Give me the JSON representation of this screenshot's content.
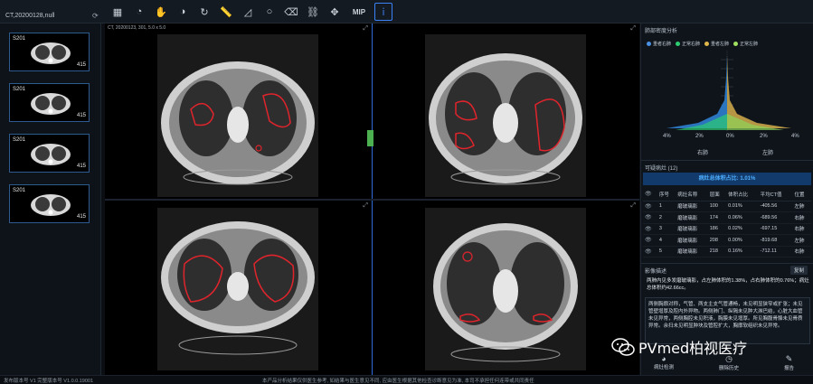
{
  "app": {
    "study_title": "CT,20200128,null",
    "study_icon": "refresh-icon"
  },
  "toolbar": {
    "tools": [
      {
        "name": "layout-grid-icon",
        "glyph": "▦",
        "active": false
      },
      {
        "name": "magnifier-icon",
        "glyph": "◔",
        "active": false
      },
      {
        "name": "pan-hand-icon",
        "glyph": "✋",
        "active": false
      },
      {
        "name": "window-level-icon",
        "glyph": "◑",
        "active": false
      },
      {
        "name": "reset-icon",
        "glyph": "↻",
        "active": false
      },
      {
        "name": "ruler-icon",
        "glyph": "📏",
        "active": false
      },
      {
        "name": "angle-icon",
        "glyph": "◿",
        "active": false
      },
      {
        "name": "ellipse-roi-icon",
        "glyph": "○",
        "active": false
      },
      {
        "name": "eraser-icon",
        "glyph": "⌫",
        "active": false
      },
      {
        "name": "link-icon",
        "glyph": "⛓",
        "active": false
      },
      {
        "name": "move-icon",
        "glyph": "✥",
        "active": false
      },
      {
        "name": "mip-button",
        "glyph": "MIP",
        "active": false
      },
      {
        "name": "info-icon",
        "glyph": "ⅰ",
        "active": true
      }
    ]
  },
  "series": [
    {
      "label": "S201",
      "count": "415"
    },
    {
      "label": "S201",
      "count": "415"
    },
    {
      "label": "S201",
      "count": "415"
    },
    {
      "label": "S201",
      "count": "415"
    }
  ],
  "viewer": {
    "viewport_info": "CT, 20200123, 301, 5.0 x 5.0"
  },
  "density_panel": {
    "title": "肺部密度分析",
    "legend": [
      {
        "label": "重者右肺",
        "color": "#4a90e2"
      },
      {
        "label": "正常右肺",
        "color": "#2ecc71"
      },
      {
        "label": "重者左肺",
        "color": "#e0b64a"
      },
      {
        "label": "正常左肺",
        "color": "#a0e060"
      }
    ],
    "axis_ticks": [
      "4%",
      "2%",
      "0%",
      "2%",
      "4%"
    ],
    "side_labels": {
      "right": "右肺",
      "left": "左肺"
    }
  },
  "lesion_panel": {
    "title": "可疑病灶 (12)",
    "ratio_text": "病灶总体积占比: 1.01%",
    "columns": [
      "序号",
      "病灶名称",
      "层面",
      "体积占比",
      "平均CT值",
      "位置"
    ],
    "rows": [
      [
        "1",
        "磨玻璃影",
        "100",
        "0.01%",
        "-405.56",
        "左肺"
      ],
      [
        "2",
        "磨玻璃影",
        "174",
        "0.06%",
        "-689.56",
        "右肺"
      ],
      [
        "3",
        "磨玻璃影",
        "186",
        "0.02%",
        "-697.15",
        "右肺"
      ],
      [
        "4",
        "磨玻璃影",
        "208",
        "0.00%",
        "-819.68",
        "左肺"
      ],
      [
        "5",
        "磨玻璃影",
        "218",
        "0.16%",
        "-712.11",
        "右肺"
      ]
    ]
  },
  "description": {
    "title": "影像描述",
    "copy_label": "复制",
    "summary": "两肺内见多发磨玻璃影，占左肺体积的1.38%，占右肺体积的0.76%；病灶总体积约42.66cc。",
    "detail": "两侧胸廓对称，气管、两支主支气管通畅，未见明显狭窄或扩张；未见管壁增厚及腔内外异物。两侧肺门、纵隔未见肿大淋巴结，心脏大血管未见异常，两侧胸腔未见积液，胸膜未见增厚。所见胸腹骨骼未见骨质异常。余扫未见明显肿块及管腔扩大，胸廓软组织未见异常。"
  },
  "actions": [
    {
      "name": "lesion-detect-button",
      "icon": "◕",
      "label": "病灶检测"
    },
    {
      "name": "history-button",
      "icon": "◷",
      "label": "删除历史"
    },
    {
      "name": "report-button",
      "icon": "✎",
      "label": "报告"
    }
  ],
  "footer": {
    "version": "发布版本号 V1 完整版本号 V1.0.0.19001",
    "disclaimer": "本产品分析结果仅供医生参考, 如结果与医生意见不同, 应由医生根据其他检查诊断意见为准, 本司不承担任何连带或共同责任"
  },
  "watermark": {
    "text": "PVmed柏视医疗",
    "icon": "wechat-icon"
  }
}
